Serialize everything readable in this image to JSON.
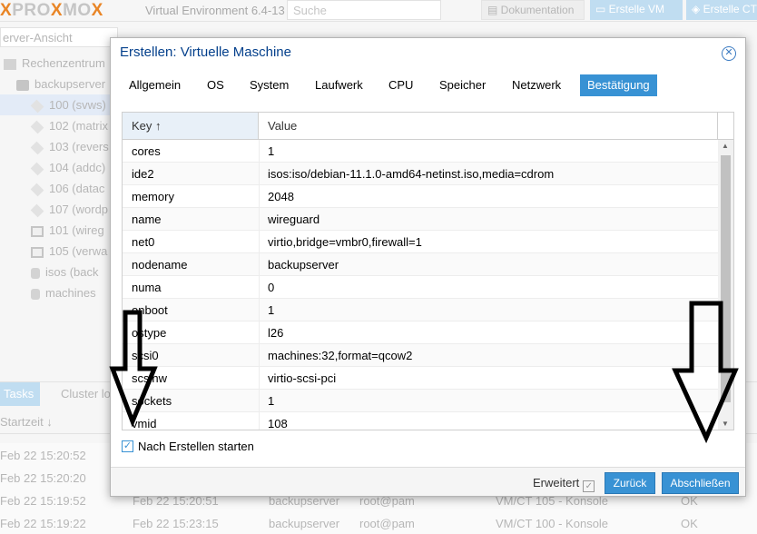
{
  "header": {
    "logo_text": "PROXMOX",
    "version": "Virtual Environment 6.4-13",
    "search_placeholder": "Suche",
    "doc_label": "Dokumentation",
    "create_vm_label": "Erstelle VM",
    "create_ct_label": "Erstelle CT"
  },
  "sidebar": {
    "view": "erver-Ansicht",
    "items": [
      {
        "label": "Rechenzentrum",
        "icon": "datacenter-icon"
      },
      {
        "label": "backupserver",
        "icon": "server-icon"
      },
      {
        "label": "100 (svws)",
        "icon": "container-icon"
      },
      {
        "label": "102 (matrix",
        "icon": "container-icon"
      },
      {
        "label": "103 (revers",
        "icon": "container-icon"
      },
      {
        "label": "104 (addc)",
        "icon": "container-icon"
      },
      {
        "label": "106 (datac",
        "icon": "container-icon"
      },
      {
        "label": "107 (wordp",
        "icon": "container-icon"
      },
      {
        "label": "101 (wireg",
        "icon": "vm-icon"
      },
      {
        "label": "105 (verwa",
        "icon": "vm-icon"
      },
      {
        "label": "isos (back",
        "icon": "storage-icon"
      },
      {
        "label": "machines",
        "icon": "storage-icon"
      }
    ]
  },
  "tasks": {
    "tab_tasks": "Tasks",
    "tab_cluster": "Cluster lo",
    "col_start": "Startzeit ↓",
    "rows": [
      {
        "start": "Feb 22 15:20:52",
        "end": "",
        "node": "",
        "user": "",
        "desc": "",
        "status": ""
      },
      {
        "start": "Feb 22 15:20:20",
        "end": "",
        "node": "",
        "user": "",
        "desc": "",
        "status": ""
      },
      {
        "start": "Feb 22 15:19:52",
        "end": "Feb 22 15:20:51",
        "node": "backupserver",
        "user": "root@pam",
        "desc": "VM/CT 105 - Konsole",
        "status": "OK"
      },
      {
        "start": "Feb 22 15:19:22",
        "end": "Feb 22 15:23:15",
        "node": "backupserver",
        "user": "root@pam",
        "desc": "VM/CT 100 - Konsole",
        "status": "OK"
      }
    ]
  },
  "dialog": {
    "title": "Erstellen: Virtuelle Maschine",
    "tabs": [
      "Allgemein",
      "OS",
      "System",
      "Laufwerk",
      "CPU",
      "Speicher",
      "Netzwerk",
      "Bestätigung"
    ],
    "active_tab": "Bestätigung",
    "grid": {
      "col_key": "Key ↑",
      "col_value": "Value",
      "rows": [
        {
          "key": "cores",
          "value": "1"
        },
        {
          "key": "ide2",
          "value": "isos:iso/debian-11.1.0-amd64-netinst.iso,media=cdrom"
        },
        {
          "key": "memory",
          "value": "2048"
        },
        {
          "key": "name",
          "value": "wireguard"
        },
        {
          "key": "net0",
          "value": "virtio,bridge=vmbr0,firewall=1"
        },
        {
          "key": "nodename",
          "value": "backupserver"
        },
        {
          "key": "numa",
          "value": "0"
        },
        {
          "key": "onboot",
          "value": "1"
        },
        {
          "key": "ostype",
          "value": "l26"
        },
        {
          "key": "scsi0",
          "value": "machines:32,format=qcow2"
        },
        {
          "key": "scsihw",
          "value": "virtio-scsi-pci"
        },
        {
          "key": "sockets",
          "value": "1"
        },
        {
          "key": "vmid",
          "value": "108"
        }
      ]
    },
    "start_after_create_label": "Nach Erstellen starten",
    "start_after_create_checked": true,
    "advanced_label": "Erweitert",
    "back_label": "Zurück",
    "finish_label": "Abschließen"
  },
  "colors": {
    "accent": "#3892d4",
    "title": "#04408c",
    "logo_x": "#e57000"
  }
}
